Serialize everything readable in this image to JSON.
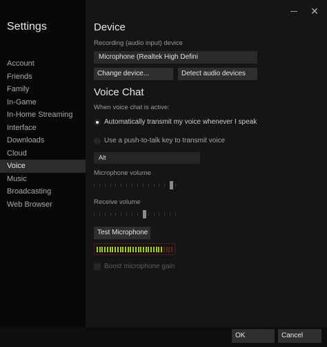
{
  "sidebar": {
    "title": "Settings",
    "items": [
      {
        "label": "Account"
      },
      {
        "label": "Friends"
      },
      {
        "label": "Family"
      },
      {
        "label": "In-Game"
      },
      {
        "label": "In-Home Streaming"
      },
      {
        "label": "Interface"
      },
      {
        "label": "Downloads"
      },
      {
        "label": "Cloud"
      },
      {
        "label": "Voice",
        "active": true
      },
      {
        "label": "Music"
      },
      {
        "label": "Broadcasting"
      },
      {
        "label": "Web Browser"
      }
    ]
  },
  "device": {
    "title": "Device",
    "recording_label": "Recording (audio input) device",
    "recording_value": "Microphone (Realtek High Defini",
    "change_button": "Change device...",
    "detect_button": "Detect audio devices"
  },
  "voice_chat": {
    "title": "Voice Chat",
    "active_label": "When voice chat is active:",
    "option_auto": "Automatically transmit my voice whenever I speak",
    "option_ptt": "Use a push-to-talk key to transmit voice",
    "selected_option": "auto",
    "ptt_key": "Alt",
    "mic_volume_label": "Microphone volume",
    "mic_volume_level": 0.94,
    "receive_volume_label": "Receive volume",
    "receive_volume_level": 0.61,
    "test_button": "Test Microphone",
    "meter_level": 0.85,
    "boost_label": "Boost microphone gain",
    "boost_checked": false
  },
  "footer": {
    "ok_label": "OK",
    "cancel_label": "Cancel"
  },
  "icons": {
    "minimize": "minimize-icon",
    "close": "close-icon"
  },
  "colors": {
    "meter_active": "#9ccf3a",
    "meter_inactive": "#4a2c20",
    "meter_bg": "#1f1010"
  }
}
